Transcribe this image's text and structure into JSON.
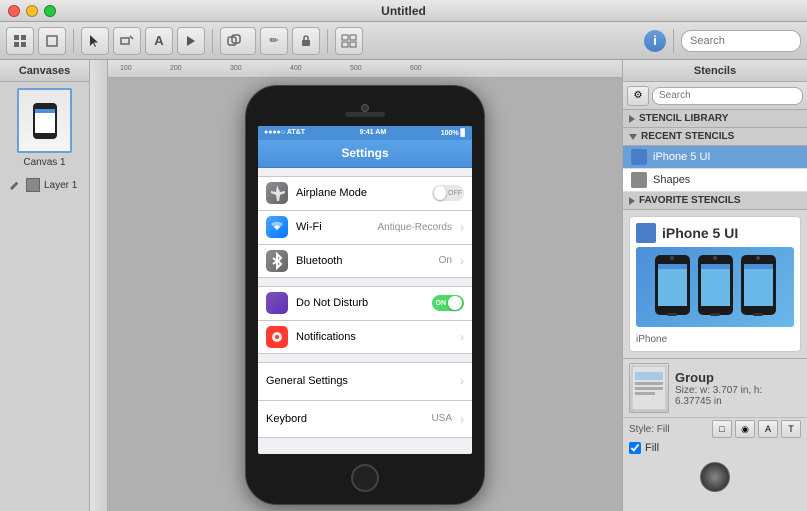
{
  "window": {
    "title": "Untitled",
    "stencils_title": "Stencils"
  },
  "titlebar": {
    "title": "Untitled"
  },
  "canvases": {
    "header": "Canvases",
    "canvas_label": "Canvas 1",
    "layer_label": "Layer 1"
  },
  "ios_settings": {
    "navbar_title": "Settings",
    "rows": [
      {
        "label": "Airplane Mode",
        "value": "OFF",
        "type": "toggle_off"
      },
      {
        "label": "Wi-Fi",
        "value": "Antique-Records",
        "type": "arrow"
      },
      {
        "label": "Bluetooth",
        "value": "On",
        "type": "arrow"
      },
      {
        "label": "Do Not Disturb",
        "value": "ON",
        "type": "toggle_on"
      },
      {
        "label": "Notifications",
        "value": "",
        "type": "arrow"
      }
    ],
    "section_rows": [
      {
        "label": "General Settings",
        "value": "",
        "type": "arrow"
      },
      {
        "label": "Keybord",
        "value": "USA",
        "type": "arrow"
      }
    ]
  },
  "stencils": {
    "header": "Stencils",
    "sections": {
      "library": "STENCIL LIBRARY",
      "recent": "RECENT STENCILS"
    },
    "items": [
      {
        "label": "iPhone 5 UI",
        "selected": true
      },
      {
        "label": "Shapes",
        "selected": false
      }
    ],
    "favorite_label": "FAVORITE STENCILS",
    "card": {
      "title": "iPhone 5 UI",
      "subtitle": "iPhone"
    }
  },
  "properties": {
    "group_label": "Group",
    "size_label": "Size: w: 3.707 in, h: 6.37745 in",
    "style_label": "Style: Fill",
    "fill_label": "Fill"
  },
  "toolbar": {
    "search_placeholder": "Search"
  }
}
